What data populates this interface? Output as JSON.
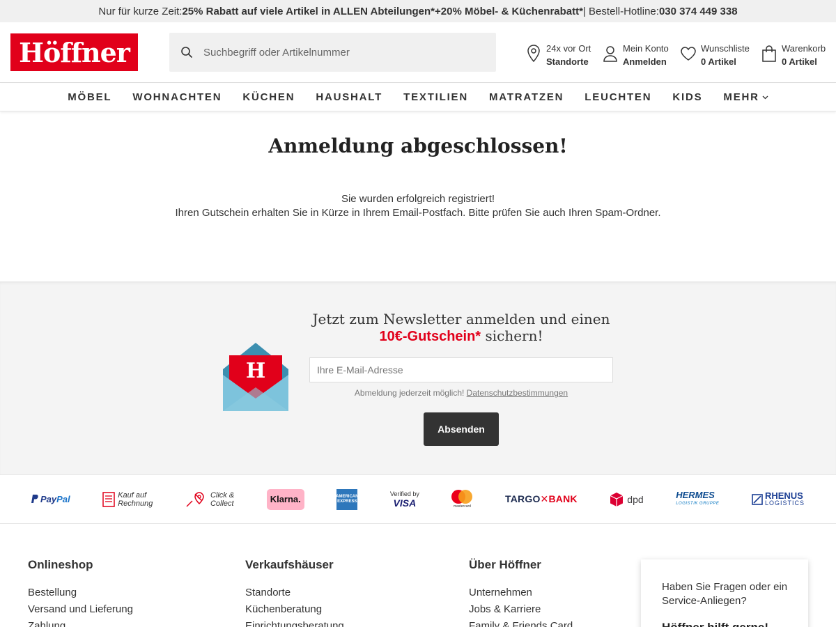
{
  "promo": {
    "lead": "Nur für kurze Zeit: ",
    "offer": "25% Rabatt auf viele Artikel in ALLEN Abteilungen*+20% Möbel- & Küchenrabatt*",
    "separator": " | Bestell-Hotline: ",
    "hotline": "030 374 449 338"
  },
  "brand": {
    "logo_text": "Höffner",
    "color": "#e1001a"
  },
  "search": {
    "placeholder": "Suchbegriff oder Artikelnummer",
    "icon": "search-icon"
  },
  "header_actions": {
    "stores": {
      "top": "24x vor Ort",
      "bottom": "Standorte",
      "icon": "location-pin-icon"
    },
    "account": {
      "top": "Mein Konto",
      "bottom": "Anmelden",
      "icon": "user-icon"
    },
    "wishlist": {
      "top": "Wunschliste",
      "bottom": "0 Artikel",
      "icon": "heart-icon"
    },
    "cart": {
      "top": "Warenkorb",
      "bottom": "0 Artikel",
      "icon": "shopping-bag-icon"
    }
  },
  "nav": {
    "items": [
      "MÖBEL",
      "WOHNACHTEN",
      "KÜCHEN",
      "HAUSHALT",
      "TEXTILIEN",
      "MATRATZEN",
      "LEUCHTEN",
      "KIDS",
      "MEHR"
    ]
  },
  "main": {
    "title": "Anmeldung abgeschlossen!",
    "line1": "Sie wurden erfolgreich registriert!",
    "line2": "Ihren Gutschein erhalten Sie in Kürze in Ihrem Email-Postfach. Bitte prüfen Sie auch Ihren Spam-Ordner."
  },
  "newsletter": {
    "headline_1": "Jetzt zum Newsletter anmelden und einen",
    "voucher": "10€-Gutschein*",
    "headline_2": " sichern!",
    "email_placeholder": "Ihre E-Mail-Adresse",
    "note": "Abmeldung jederzeit möglich! ",
    "privacy_link": "Datenschutzbestimmungen",
    "submit": "Absenden",
    "envelope_letter": "H"
  },
  "payments": {
    "paypal_1": "Pay",
    "paypal_2": "Pal",
    "invoice_1": "Kauf auf",
    "invoice_2": "Rechnung",
    "click_1": "Click &",
    "click_2": "Collect",
    "klarna": "Klarna.",
    "amex": "AMERICAN EXPRESS",
    "visa_top": "Verified by",
    "visa_bottom": "VISA",
    "mastercard": "mastercard",
    "targo_1": "TARGO",
    "targo_x": "✕",
    "targo_2": "BANK",
    "dpd": "dpd",
    "hermes": "HERMES",
    "hermes_sub": "LOGISTIK GRUPPE",
    "rhenus_1": "RHENUS",
    "rhenus_2": "LOGISTICS"
  },
  "footer": {
    "col1": {
      "title": "Onlineshop",
      "links": [
        "Bestellung",
        "Versand und Lieferung",
        "Zahlung"
      ]
    },
    "col2": {
      "title": "Verkaufshäuser",
      "links": [
        "Standorte",
        "Küchenberatung",
        "Einrichtungsberatung"
      ]
    },
    "col3": {
      "title": "Über Höffner",
      "links": [
        "Unternehmen",
        "Jobs & Karriere",
        "Family & Friends Card"
      ]
    },
    "help": {
      "text": "Haben Sie Fragen oder ein Service-Anliegen?",
      "title": "Höffner hilft gerne!"
    }
  }
}
